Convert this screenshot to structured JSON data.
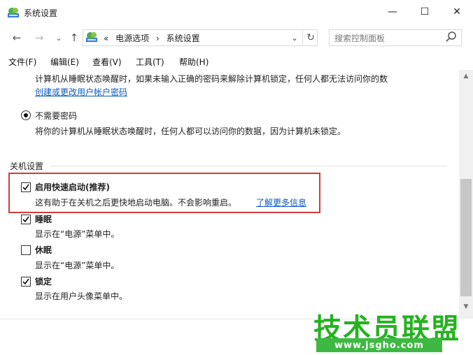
{
  "window": {
    "title": "系统设置",
    "minimize": "—",
    "maximize": "☐",
    "close": "✕"
  },
  "nav": {
    "back": "←",
    "forward": "→",
    "recent": "⌄",
    "up": "↑"
  },
  "address": {
    "overflow": "«",
    "crumbs": [
      "电源选项",
      "›",
      "系统设置"
    ],
    "dropdown": "⌄",
    "refresh": "↻"
  },
  "search": {
    "placeholder": "搜索控制面板"
  },
  "menu": {
    "file": "文件(F)",
    "edit": "编辑(E)",
    "view": "查看(V)",
    "tools": "工具(T)",
    "help": "帮助(H)"
  },
  "password": {
    "require_desc": "计算机从睡眠状态唤醒时，如果未输入正确的密码来解除计算机锁定，任何人都无法访问你的数",
    "create_link": "创建或更改用户帐户密码",
    "no_password_label": "不需要密码",
    "no_password_desc": "将你的计算机从睡眠状态唤醒时，任何人都可以访问你的数据，因为计算机未锁定。",
    "no_password_selected": true
  },
  "shutdown": {
    "section_title": "关机设置",
    "fast_startup_label": "启用快速启动(推荐)",
    "fast_startup_desc": "这有助于在关机之后更快地启动电脑。不会影响重启。",
    "learn_more": "了解更多信息",
    "fast_startup_checked": true,
    "sleep_label": "睡眠",
    "sleep_desc": "显示在“电源”菜单中。",
    "sleep_checked": true,
    "hibernate_label": "休眠",
    "hibernate_desc": "显示在“电源”菜单中。",
    "hibernate_checked": false,
    "lock_label": "锁定",
    "lock_desc": "显示在用户头像菜单中。",
    "lock_checked": true
  },
  "scrollbar": {
    "up": "▲",
    "down": "▼"
  },
  "watermark": {
    "title": "技术员联盟",
    "url": "www.jsgho.com"
  },
  "colors": {
    "highlight": "#d33a3a",
    "link": "#0b5bbf",
    "watermark_green": "#25b21f"
  }
}
